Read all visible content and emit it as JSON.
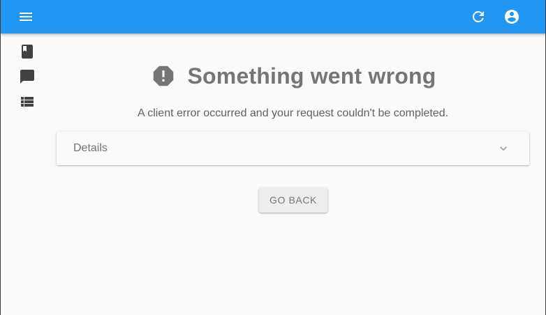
{
  "appbar": {
    "color": "#2196f3",
    "icons": {
      "menu": "menu-icon",
      "refresh": "refresh-icon",
      "account": "account-circle-icon"
    }
  },
  "sidebar": {
    "items": [
      {
        "icon": "book-icon"
      },
      {
        "icon": "chat-icon"
      },
      {
        "icon": "list-icon"
      }
    ]
  },
  "error": {
    "title": "Something went wrong",
    "message": "A client error occurred and your request couldn't be completed.",
    "icon": "error-octagon-icon"
  },
  "details": {
    "label": "Details",
    "icon": "chevron-down-icon"
  },
  "actions": {
    "go_back_label": "GO BACK"
  }
}
